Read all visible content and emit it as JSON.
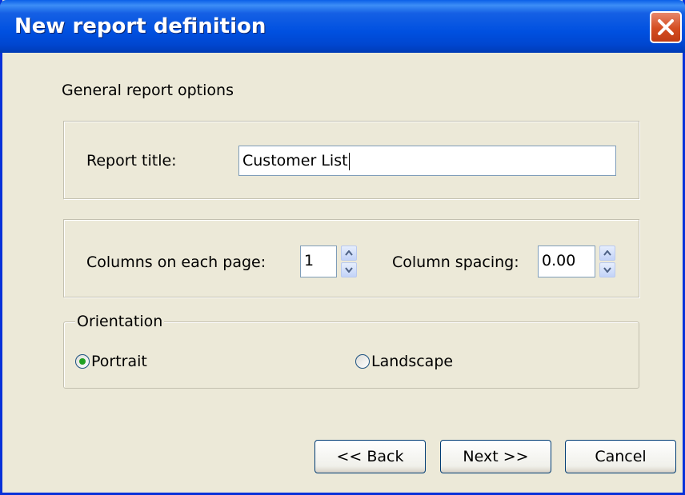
{
  "window": {
    "title": "New report definition"
  },
  "section_title": "General report options",
  "report_title": {
    "label": "Report title:",
    "value": "Customer List"
  },
  "columns": {
    "columns_label": "Columns on each page:",
    "columns_value": "1",
    "spacing_label": "Column spacing:",
    "spacing_value": "0.00"
  },
  "orientation": {
    "legend": "Orientation",
    "portrait": "Portrait",
    "landscape": "Landscape",
    "selected": "Portrait"
  },
  "buttons": {
    "back": "<< Back",
    "next": "Next >>",
    "cancel": "Cancel"
  },
  "icons": {
    "close": "close-icon",
    "spin_up": "arrow-up-icon",
    "spin_down": "arrow-down-icon",
    "radio": "radio-icon"
  },
  "colors": {
    "titlebar": "#0050e0",
    "close": "#d44d21",
    "dialog_bg": "#ece9d8",
    "radio_selected": "#21a121"
  }
}
